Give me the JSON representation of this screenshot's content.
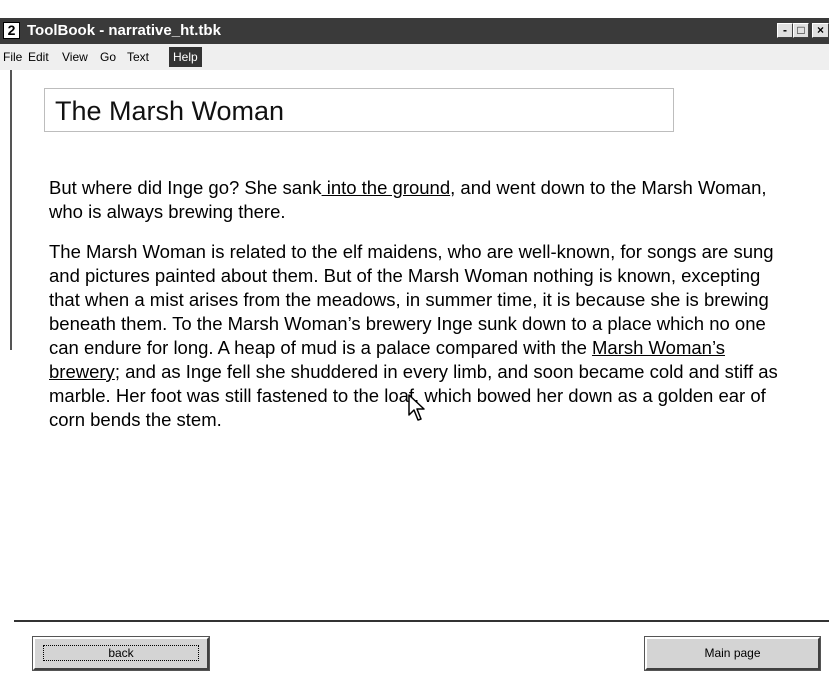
{
  "window": {
    "title": "ToolBook - narrative_ht.tbk",
    "icon_glyph": "2",
    "controls": {
      "minimize": "-",
      "maximize": "□",
      "close": "×"
    }
  },
  "menu": [
    {
      "label": "File"
    },
    {
      "label": "Edit"
    },
    {
      "label": "View"
    },
    {
      "label": "Go"
    },
    {
      "label": "Text"
    },
    {
      "label": "Help"
    }
  ],
  "page": {
    "title": "The Marsh Woman",
    "p1": {
      "before": "But where did Inge go? She sank",
      "link": " into the ground",
      "after": ", and went down to the Marsh Woman, who is always brewing there."
    },
    "p2": {
      "before": "The Marsh Woman is related to the elf maidens, who are well-known, for songs are sung and pictures painted about them. But of the Marsh Woman nothing is known, excepting that when a mist arises from the meadows, in summer time, it is because she is brewing beneath them. To the Marsh Woman’s brewery Inge sunk down to a place which no one can endure for long. A heap of mud is a palace compared with the ",
      "link": "Marsh Woman’s brewery",
      "after": "; and as Inge fell she shuddered in every limb, and soon became cold and stiff as marble. Her foot was still fastened to the loaf, which bowed her down as a golden ear of corn bends the stem."
    }
  },
  "buttons": {
    "back": "back",
    "main": "Main page"
  }
}
